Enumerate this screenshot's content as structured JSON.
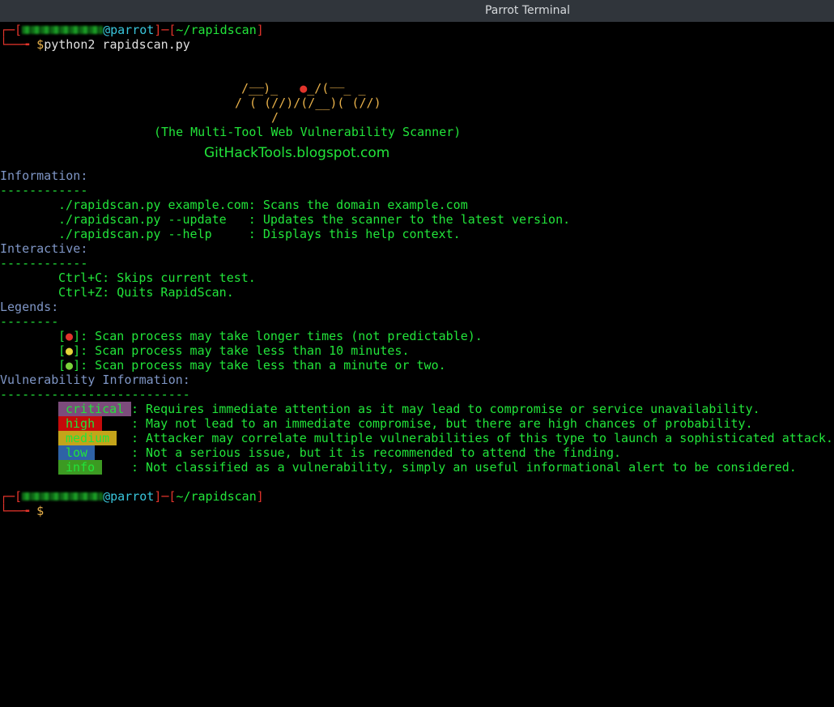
{
  "window": {
    "title": "Parrot Terminal"
  },
  "prompt1": {
    "open": "┌─[",
    "at_host": "@parrot",
    "mid": "]─[",
    "path": "~/rapidscan",
    "close": "]",
    "arrow": "└──╼ ",
    "symbol": "$",
    "command": "python2 rapidscan.py"
  },
  "banner": {
    "line1": "__         __",
    "line2a": "/__)_   ",
    "line2dot": "●",
    "line2b": "_/(  _ _",
    "line3": "/ ( (//)/(/__)( (//)",
    "line4": "/",
    "subtitle": "(The Multi-Tool Web Vulnerability Scanner)",
    "blog": "GitHackTools.blogspot.com"
  },
  "information": {
    "heading": "Information:",
    "rule": "------------",
    "lines": [
      "./rapidscan.py example.com: Scans the domain example.com",
      "./rapidscan.py --update   : Updates the scanner to the latest version.",
      "./rapidscan.py --help     : Displays this help context."
    ]
  },
  "interactive": {
    "heading": "Interactive:",
    "rule": "------------",
    "lines": [
      "Ctrl+C: Skips current test.",
      "Ctrl+Z: Quits RapidScan."
    ]
  },
  "legends": {
    "heading": "Legends:",
    "rule": "--------",
    "items": [
      {
        "dot": "●",
        "text": "]: Scan process may take longer times (not predictable)."
      },
      {
        "dot": "●",
        "text": "]: Scan process may take less than 10 minutes."
      },
      {
        "dot": "●",
        "text": "]: Scan process may take less than a minute or two."
      }
    ]
  },
  "vuln": {
    "heading": "Vulnerability Information:",
    "rule": "--------------------------",
    "items": [
      {
        "badge": "critical",
        "text": ": Requires immediate attention as it may lead to compromise or service unavailability."
      },
      {
        "badge": "high",
        "text": ": May not lead to an immediate compromise, but there are high chances of probability."
      },
      {
        "badge": "medium",
        "text": ": Attacker may correlate multiple vulnerabilities of this type to launch a sophisticated attack."
      },
      {
        "badge": "low",
        "text": ": Not a serious issue, but it is recommended to attend the finding."
      },
      {
        "badge": "info",
        "text": ": Not classified as a vulnerability, simply an useful informational alert to be considered."
      }
    ]
  },
  "prompt2": {
    "open": "┌─[",
    "at_host": "@parrot",
    "mid": "]─[",
    "path": "~/rapidscan",
    "close": "]",
    "arrow": "└──╼ ",
    "symbol": "$"
  },
  "colors": {
    "text_green": "#22e43a",
    "prompt_red": "#e2342b",
    "host_cyan": "#39c6dc",
    "heading_blue": "#7f96c6",
    "ascii_gold": "#e8b14a",
    "critical": "#7c4c7c",
    "high": "#c50a0a",
    "medium": "#c4a41a",
    "low": "#2e62a6",
    "info": "#3c9a22"
  }
}
